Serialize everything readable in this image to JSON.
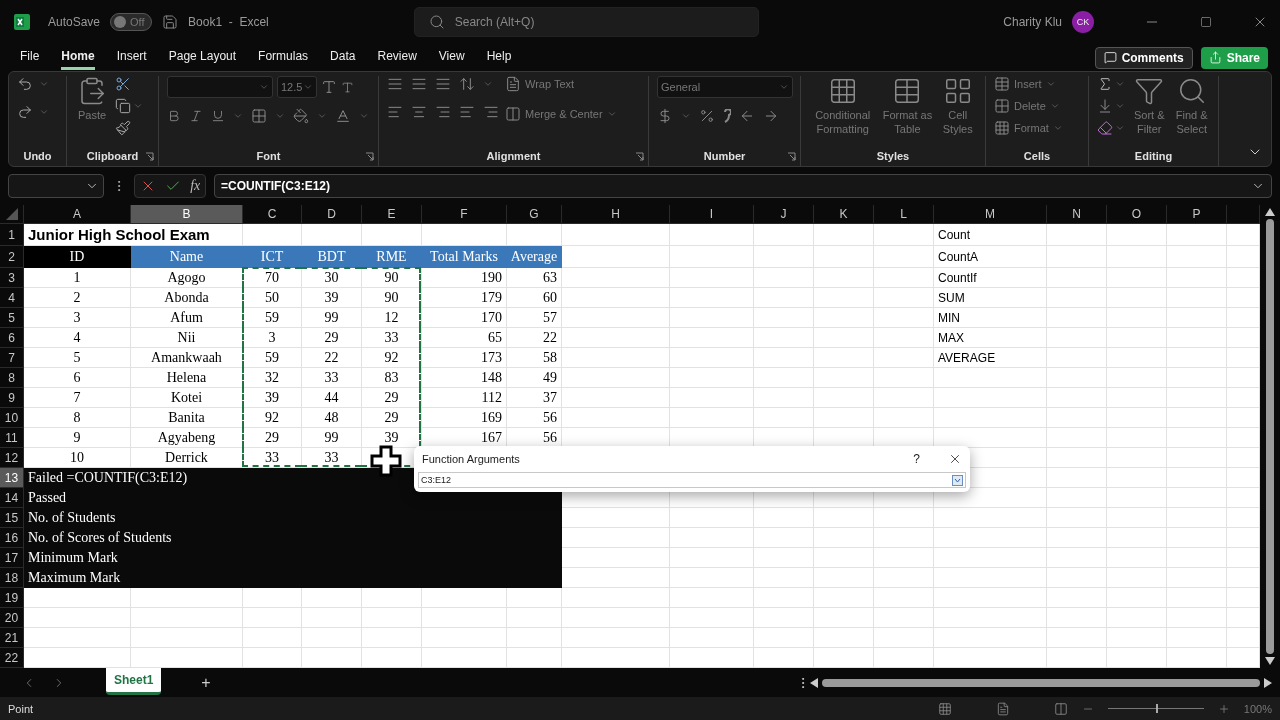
{
  "title_bar": {
    "autosave_label": "AutoSave",
    "autosave": {
      "on": false,
      "label": "Off"
    },
    "document": "Book1  -  Excel",
    "search": {
      "placeholder": "Search (Alt+Q)"
    },
    "user": {
      "name": "Charity Klu",
      "initials": "CK"
    }
  },
  "menu_tabs": [
    {
      "label": "File",
      "selected": false
    },
    {
      "label": "Home",
      "selected": true
    },
    {
      "label": "Insert",
      "selected": false
    },
    {
      "label": "Page Layout",
      "selected": false
    },
    {
      "label": "Formulas",
      "selected": false
    },
    {
      "label": "Data",
      "selected": false
    },
    {
      "label": "Review",
      "selected": false
    },
    {
      "label": "View",
      "selected": false
    },
    {
      "label": "Help",
      "selected": false
    }
  ],
  "actions": [
    {
      "label": "Comments",
      "kind": "outline"
    },
    {
      "label": "Share",
      "kind": "primary"
    }
  ],
  "ribbon": [
    {
      "label": "Undo",
      "kind": "undo",
      "launcher": false
    },
    {
      "label": "Clipboard",
      "kind": "clipboard",
      "launcher": true,
      "paste": "Paste"
    },
    {
      "label": "Font",
      "kind": "font",
      "launcher": true,
      "font_size": "12.5"
    },
    {
      "label": "Alignment",
      "kind": "alignment",
      "launcher": true,
      "wrap": "Wrap Text",
      "merge": "Merge & Center"
    },
    {
      "label": "Number",
      "kind": "number",
      "launcher": true,
      "format": "General"
    },
    {
      "label": "Styles",
      "kind": "styles",
      "launcher": false,
      "items": [
        "Conditional Formatting",
        "Format as Table",
        "Cell Styles"
      ]
    },
    {
      "label": "Cells",
      "kind": "cells",
      "launcher": false,
      "items": [
        "Insert",
        "Delete",
        "Format"
      ]
    },
    {
      "label": "Editing",
      "kind": "editing",
      "launcher": false,
      "items": [
        "Sort & Filter",
        "Find & Select"
      ]
    }
  ],
  "formula_bar": {
    "function_label": "fx",
    "formula": "=COUNTIF(C3:E12)"
  },
  "columns": [
    {
      "label": "A",
      "selected": false,
      "in_reference": false
    },
    {
      "label": "B",
      "selected": true,
      "in_reference": false
    },
    {
      "label": "C",
      "selected": false,
      "in_reference": true
    },
    {
      "label": "D",
      "selected": false,
      "in_reference": true
    },
    {
      "label": "E",
      "selected": false,
      "in_reference": true
    },
    {
      "label": "F",
      "selected": false,
      "in_reference": false
    },
    {
      "label": "G",
      "selected": false,
      "in_reference": false
    },
    {
      "label": "H",
      "selected": false,
      "in_reference": false
    },
    {
      "label": "I",
      "selected": false,
      "in_reference": false
    },
    {
      "label": "J",
      "selected": false,
      "in_reference": false
    },
    {
      "label": "K",
      "selected": false,
      "in_reference": false
    },
    {
      "label": "L",
      "selected": false,
      "in_reference": false
    },
    {
      "label": "M",
      "selected": false,
      "in_reference": false
    },
    {
      "label": "N",
      "selected": false,
      "in_reference": false
    },
    {
      "label": "O",
      "selected": false,
      "in_reference": false
    },
    {
      "label": "P",
      "selected": false,
      "in_reference": false
    }
  ],
  "rows": [
    {
      "number": "1",
      "kind": "title",
      "selected": false,
      "in_reference": false,
      "cells": [
        "Junior High School Exam"
      ],
      "note": "Count"
    },
    {
      "number": "2",
      "kind": "header",
      "selected": false,
      "in_reference": false,
      "cells": [
        "ID",
        "Name",
        "ICT",
        "BDT",
        "RME",
        "Total Marks",
        "Average"
      ],
      "note": "CountA"
    },
    {
      "number": "3",
      "kind": "data",
      "selected": false,
      "in_reference": true,
      "cells": [
        "1",
        "Agogo",
        "70",
        "30",
        "90",
        "190",
        "63"
      ],
      "note": "CountIf"
    },
    {
      "number": "4",
      "kind": "data",
      "selected": false,
      "in_reference": true,
      "cells": [
        "2",
        "Abonda",
        "50",
        "39",
        "90",
        "179",
        "60"
      ],
      "note": "SUM"
    },
    {
      "number": "5",
      "kind": "data",
      "selected": false,
      "in_reference": true,
      "cells": [
        "3",
        "Afum",
        "59",
        "99",
        "12",
        "170",
        "57"
      ],
      "note": "MIN"
    },
    {
      "number": "6",
      "kind": "data",
      "selected": false,
      "in_reference": true,
      "cells": [
        "4",
        "Nii",
        "3",
        "29",
        "33",
        "65",
        "22"
      ],
      "note": "MAX"
    },
    {
      "number": "7",
      "kind": "data",
      "selected": false,
      "in_reference": true,
      "cells": [
        "5",
        "Amankwaah",
        "59",
        "22",
        "92",
        "173",
        "58"
      ],
      "note": "AVERAGE"
    },
    {
      "number": "8",
      "kind": "data",
      "selected": false,
      "in_reference": true,
      "cells": [
        "6",
        "Helena",
        "32",
        "33",
        "83",
        "148",
        "49"
      ]
    },
    {
      "number": "9",
      "kind": "data",
      "selected": false,
      "in_reference": true,
      "cells": [
        "7",
        "Kotei",
        "39",
        "44",
        "29",
        "112",
        "37"
      ]
    },
    {
      "number": "10",
      "kind": "data",
      "selected": false,
      "in_reference": true,
      "cells": [
        "8",
        "Banita",
        "92",
        "48",
        "29",
        "169",
        "56"
      ]
    },
    {
      "number": "11",
      "kind": "data",
      "selected": false,
      "in_reference": true,
      "cells": [
        "9",
        "Agyabeng",
        "29",
        "99",
        "39",
        "167",
        "56"
      ]
    },
    {
      "number": "12",
      "kind": "data",
      "selected": false,
      "in_reference": true,
      "cells": [
        "10",
        "Derrick",
        "33",
        "33"
      ]
    },
    {
      "number": "13",
      "kind": "summary",
      "selected": true,
      "in_reference": false,
      "cells": [
        "Failed =COUNTIF(C3:E12)"
      ]
    },
    {
      "number": "14",
      "kind": "summary",
      "selected": false,
      "in_reference": false,
      "cells": [
        "Passed"
      ]
    },
    {
      "number": "15",
      "kind": "summary",
      "selected": false,
      "in_reference": false,
      "cells": [
        "No. of Students"
      ]
    },
    {
      "number": "16",
      "kind": "summary",
      "selected": false,
      "in_reference": false,
      "cells": [
        "No. of Scores of Students"
      ]
    },
    {
      "number": "17",
      "kind": "summary",
      "selected": false,
      "in_reference": false,
      "cells": [
        "Minimum Mark"
      ]
    },
    {
      "number": "18",
      "kind": "summary",
      "selected": false,
      "in_reference": false,
      "cells": [
        "Maximum Mark"
      ]
    },
    {
      "number": "19",
      "kind": "empty",
      "selected": false,
      "in_reference": false,
      "cells": []
    },
    {
      "number": "20",
      "kind": "empty",
      "selected": false,
      "in_reference": false,
      "cells": []
    },
    {
      "number": "21",
      "kind": "empty",
      "selected": false,
      "in_reference": false,
      "cells": []
    },
    {
      "number": "22",
      "kind": "empty",
      "selected": false,
      "in_reference": false,
      "cells": []
    }
  ],
  "dialog": {
    "title": "Function Arguments",
    "help": "?",
    "value": "C3:E12"
  },
  "sheet_tabs": [
    {
      "label": "Sheet1",
      "selected": true
    }
  ],
  "add_sheet": "+",
  "status_bar": {
    "mode": "Point",
    "zoom": {
      "level": 0.5,
      "reading": "100%"
    }
  }
}
